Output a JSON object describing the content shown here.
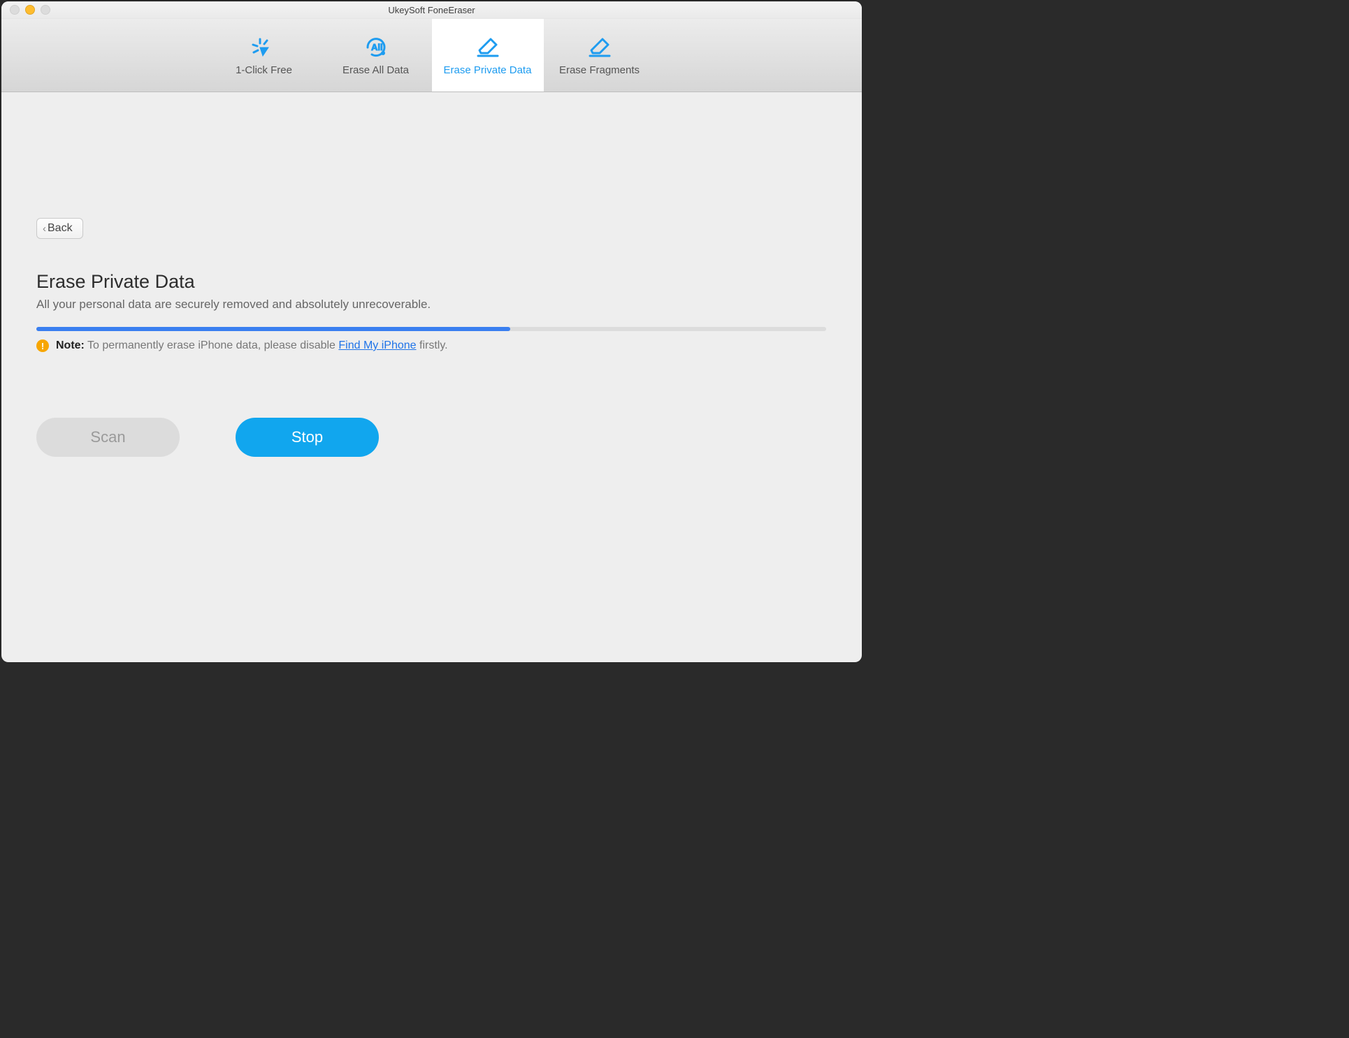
{
  "window": {
    "title": "UkeySoft FoneEraser"
  },
  "toolbar": {
    "tabs": [
      {
        "label": "1-Click Free"
      },
      {
        "label": "Erase All Data"
      },
      {
        "label": "Erase Private Data"
      },
      {
        "label": "Erase Fragments"
      }
    ]
  },
  "back": {
    "label": "Back"
  },
  "main": {
    "heading": "Erase Private Data",
    "subheading": "All your personal data are securely removed and absolutely unrecoverable.",
    "progress_percent": 60
  },
  "note": {
    "prefix": "Note:",
    "body_before": " To permanently erase iPhone data, please disable ",
    "link": "Find My iPhone",
    "body_after": " firstly."
  },
  "buttons": {
    "scan": "Scan",
    "stop": "Stop"
  }
}
